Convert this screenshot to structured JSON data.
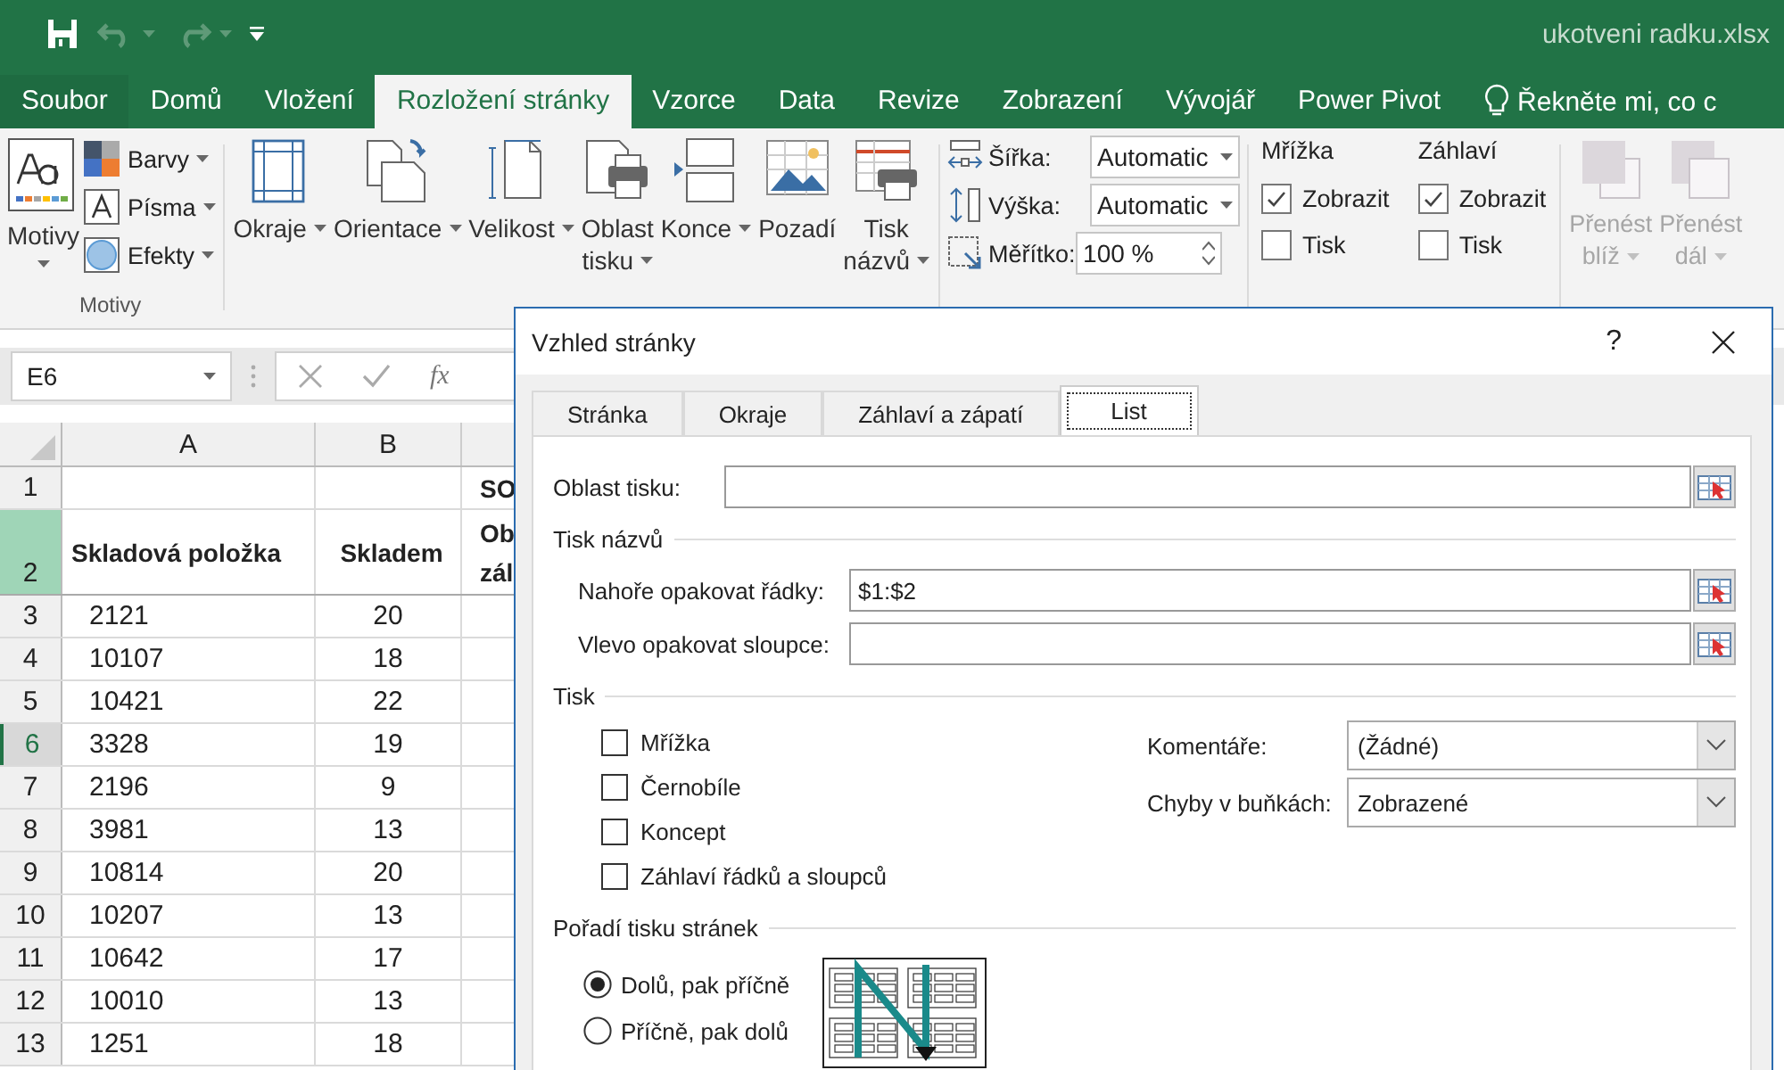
{
  "title_bar": {
    "file_name": "ukotveni radku.xlsx",
    "undo_disabled": true
  },
  "ribbon_tabs": [
    {
      "label": "Soubor",
      "selected": false
    },
    {
      "label": "Domů",
      "selected": false
    },
    {
      "label": "Vložení",
      "selected": false
    },
    {
      "label": "Rozložení stránky",
      "selected": true
    },
    {
      "label": "Vzorce",
      "selected": false
    },
    {
      "label": "Data",
      "selected": false
    },
    {
      "label": "Revize",
      "selected": false
    },
    {
      "label": "Zobrazení",
      "selected": false
    },
    {
      "label": "Vývojář",
      "selected": false
    },
    {
      "label": "Power Pivot",
      "selected": false
    }
  ],
  "tell_me": "Řekněte mi, co c",
  "themes_group": {
    "main": "Motivy",
    "small": [
      {
        "label": "Barvy",
        "kind": "colors"
      },
      {
        "label": "Písma",
        "kind": "fonts"
      },
      {
        "label": "Efekty",
        "kind": "effects"
      }
    ],
    "group_label": "Motivy"
  },
  "page_setup_buttons": [
    {
      "label_lines": [
        "Okraje"
      ],
      "kind": "margins"
    },
    {
      "label_lines": [
        "Orientace"
      ],
      "kind": "orientation"
    },
    {
      "label_lines": [
        "Velikost"
      ],
      "kind": "size"
    },
    {
      "label_lines": [
        "Oblast",
        "tisku"
      ],
      "kind": "print-area"
    },
    {
      "label_lines": [
        "Konce"
      ],
      "kind": "breaks"
    },
    {
      "label_lines": [
        "Pozadí"
      ],
      "kind": "background"
    },
    {
      "label_lines": [
        "Tisk",
        "názvů"
      ],
      "kind": "print-titles"
    }
  ],
  "scale_group": [
    {
      "label": "Šířka:",
      "value": "Automatic",
      "kind": "dropdown"
    },
    {
      "label": "Výška:",
      "value": "Automatic",
      "kind": "dropdown"
    },
    {
      "label": "Měřítko:",
      "value": "100 %",
      "kind": "spinner"
    }
  ],
  "sheet_options": [
    {
      "title": "Mřížka",
      "options": [
        {
          "label": "Zobrazit",
          "checked": true
        },
        {
          "label": "Tisk",
          "checked": false
        }
      ]
    },
    {
      "title": "Záhlaví",
      "options": [
        {
          "label": "Zobrazit",
          "checked": true
        },
        {
          "label": "Tisk",
          "checked": false
        }
      ]
    }
  ],
  "arrange": [
    {
      "label_lines": [
        "Přenést",
        "blíž"
      ],
      "disabled": true
    },
    {
      "label_lines": [
        "Přenést",
        "dál"
      ],
      "disabled": true
    }
  ],
  "formula_bar": {
    "name_box": "E6",
    "function_label": "fx"
  },
  "sheet": {
    "columns": [
      "A",
      "B"
    ],
    "rows": [
      {
        "number": "1",
        "selected": false,
        "active": false,
        "cells": [
          null,
          null,
          "SO"
        ]
      },
      {
        "number": "2",
        "selected": true,
        "active": false,
        "cells": [
          "Skladová položka",
          "Skladem",
          "Ob\nzál"
        ]
      },
      {
        "number": "3",
        "selected": false,
        "active": false,
        "cells": [
          "2121",
          "20",
          null
        ]
      },
      {
        "number": "4",
        "selected": false,
        "active": false,
        "cells": [
          "10107",
          "18",
          null
        ]
      },
      {
        "number": "5",
        "selected": false,
        "active": false,
        "cells": [
          "10421",
          "22",
          null
        ]
      },
      {
        "number": "6",
        "selected": false,
        "active": true,
        "cells": [
          "3328",
          "19",
          null
        ]
      },
      {
        "number": "7",
        "selected": false,
        "active": false,
        "cells": [
          "2196",
          "9",
          null
        ]
      },
      {
        "number": "8",
        "selected": false,
        "active": false,
        "cells": [
          "3981",
          "13",
          null
        ]
      },
      {
        "number": "9",
        "selected": false,
        "active": false,
        "cells": [
          "10814",
          "20",
          null
        ]
      },
      {
        "number": "10",
        "selected": false,
        "active": false,
        "cells": [
          "10207",
          "13",
          null
        ]
      },
      {
        "number": "11",
        "selected": false,
        "active": false,
        "cells": [
          "10642",
          "17",
          null
        ]
      },
      {
        "number": "12",
        "selected": false,
        "active": false,
        "cells": [
          "10010",
          "13",
          null
        ]
      },
      {
        "number": "13",
        "selected": false,
        "active": false,
        "cells": [
          "1251",
          "18",
          null
        ]
      }
    ]
  },
  "dialog": {
    "title": "Vzhled stránky",
    "help": "?",
    "tabs": [
      {
        "label": "Stránka",
        "selected": false
      },
      {
        "label": "Okraje",
        "selected": false
      },
      {
        "label": "Záhlaví a zápatí",
        "selected": false
      },
      {
        "label": "List",
        "selected": true
      }
    ],
    "print_area": {
      "label": "Oblast tisku:"
    },
    "print_titles": {
      "heading": "Tisk názvů",
      "fields": [
        {
          "label": "Nahoře opakovat řádky:",
          "value": "$1:$2"
        },
        {
          "label": "Vlevo opakovat sloupce:"
        }
      ]
    },
    "print": {
      "heading": "Tisk",
      "checkboxes": [
        {
          "label": "Mřížka",
          "checked": false
        },
        {
          "label": "Černobíle",
          "checked": false
        },
        {
          "label": "Koncept",
          "checked": false
        },
        {
          "label": "Záhlaví řádků a sloupců",
          "checked": false
        }
      ],
      "dropdowns": [
        {
          "label": "Komentáře:",
          "value": "(Žádné)"
        },
        {
          "label": "Chyby v buňkách:",
          "value": "Zobrazené"
        }
      ]
    },
    "page_order": {
      "heading": "Pořadí tisku stránek",
      "options": [
        {
          "label": "Dolů, pak příčně",
          "selected": true
        },
        {
          "label": "Příčně, pak dolů",
          "selected": false
        }
      ]
    }
  }
}
